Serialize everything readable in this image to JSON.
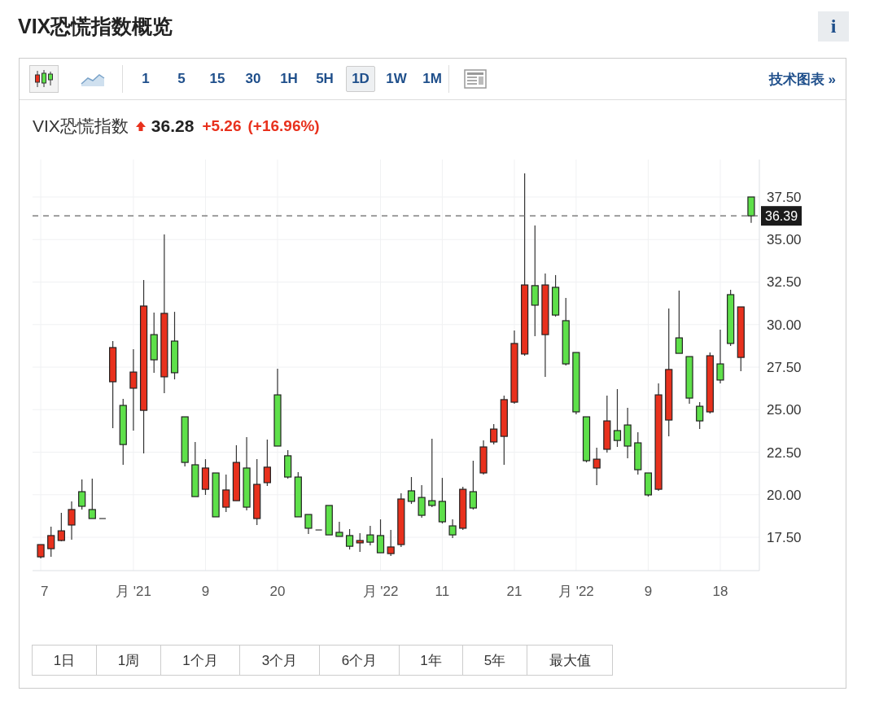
{
  "page_title": "VIX恐慌指数概览",
  "info_button": {
    "label": "i"
  },
  "toolbar": {
    "chart_types": [
      {
        "kind": "candlestick",
        "selected": true
      },
      {
        "kind": "line",
        "selected": false
      }
    ],
    "intervals": [
      {
        "label": "1",
        "selected": false
      },
      {
        "label": "5",
        "selected": false
      },
      {
        "label": "15",
        "selected": false
      },
      {
        "label": "30",
        "selected": false
      },
      {
        "label": "1H",
        "selected": false
      },
      {
        "label": "5H",
        "selected": false
      },
      {
        "label": "1D",
        "selected": true
      },
      {
        "label": "1W",
        "selected": false
      },
      {
        "label": "1M",
        "selected": false
      }
    ],
    "link": "技术图表 »"
  },
  "quote": {
    "name": "VIX恐慌指数",
    "rising": true,
    "price": "36.28",
    "change": "+5.26",
    "change_percent": "(+16.96%)"
  },
  "chart": {
    "last_price_tag": "36.39",
    "chart_data": {
      "type": "candlestick",
      "categories": [
        "7",
        null,
        null,
        null,
        null,
        null,
        null,
        null,
        null,
        "月 '21",
        null,
        null,
        null,
        null,
        null,
        null,
        "9",
        null,
        null,
        null,
        null,
        null,
        null,
        "20",
        null,
        null,
        null,
        null,
        null,
        null,
        null,
        null,
        null,
        "月 '22",
        null,
        null,
        null,
        null,
        null,
        "11",
        null,
        null,
        null,
        null,
        null,
        null,
        "21",
        null,
        null,
        null,
        null,
        null,
        "月 '22",
        null,
        null,
        null,
        null,
        null,
        null,
        "9",
        null,
        null,
        null,
        null,
        null,
        null,
        "18",
        null,
        null,
        null
      ],
      "ohlc": [
        [
          16.35,
          17.07,
          16.26,
          17.07
        ],
        [
          16.83,
          18.12,
          16.35,
          17.6
        ],
        [
          17.31,
          18.94,
          17.26,
          17.88
        ],
        [
          18.22,
          19.61,
          17.36,
          19.13
        ],
        [
          20.18,
          20.9,
          19.13,
          19.32
        ],
        [
          19.13,
          20.95,
          18.6,
          18.6
        ],
        [
          18.6,
          18.6,
          18.6,
          18.6
        ],
        [
          26.64,
          29.03,
          23.91,
          28.65
        ],
        [
          25.25,
          25.63,
          21.76,
          22.95
        ],
        [
          26.26,
          28.55,
          23.77,
          27.21
        ],
        [
          24.96,
          32.62,
          22.43,
          31.09
        ],
        [
          29.41,
          30.71,
          27.17,
          27.93
        ],
        [
          26.93,
          35.3,
          25.97,
          30.66
        ],
        [
          29.03,
          30.75,
          26.78,
          27.17
        ],
        [
          24.58,
          24.58,
          21.66,
          21.9
        ],
        [
          21.76,
          23.1,
          19.89,
          19.89
        ],
        [
          20.32,
          22.09,
          19.99,
          21.57
        ],
        [
          21.28,
          21.28,
          18.7,
          18.7
        ],
        [
          19.27,
          21.18,
          18.98,
          20.28
        ],
        [
          19.65,
          22.91,
          19.65,
          21.9
        ],
        [
          21.57,
          23.39,
          19.08,
          19.27
        ],
        [
          18.6,
          22.09,
          18.22,
          20.61
        ],
        [
          20.71,
          23.24,
          20.51,
          21.62
        ],
        [
          25.87,
          27.4,
          22.86,
          22.86
        ],
        [
          22.29,
          22.62,
          20.95,
          21.04
        ],
        [
          21.04,
          21.33,
          18.7,
          18.7
        ],
        [
          18.84,
          18.84,
          17.69,
          18.03
        ],
        [
          17.93,
          17.93,
          17.93,
          17.93
        ],
        [
          19.37,
          19.37,
          17.64,
          17.64
        ],
        [
          17.79,
          18.41,
          17.55,
          17.55
        ],
        [
          17.6,
          17.98,
          16.78,
          16.97
        ],
        [
          17.17,
          17.74,
          16.64,
          17.31
        ],
        [
          17.64,
          18.17,
          17.02,
          17.21
        ],
        [
          17.6,
          18.55,
          16.59,
          16.59
        ],
        [
          16.54,
          17.93,
          16.4,
          16.93
        ],
        [
          17.07,
          20.08,
          16.93,
          19.75
        ],
        [
          20.23,
          21.04,
          19.46,
          19.61
        ],
        [
          19.84,
          20.56,
          18.65,
          18.79
        ],
        [
          19.65,
          23.29,
          19.27,
          19.37
        ],
        [
          19.61,
          20.99,
          18.31,
          18.41
        ],
        [
          18.17,
          18.55,
          17.45,
          17.64
        ],
        [
          18.03,
          20.47,
          17.93,
          20.32
        ],
        [
          20.18,
          22.0,
          19.13,
          19.22
        ],
        [
          21.28,
          23.19,
          21.18,
          22.81
        ],
        [
          23.1,
          24.15,
          22.95,
          23.86
        ],
        [
          23.43,
          25.83,
          21.76,
          25.59
        ],
        [
          25.44,
          29.65,
          25.35,
          28.89
        ],
        [
          28.27,
          38.89,
          28.17,
          32.33
        ],
        [
          32.29,
          35.83,
          29.32,
          31.14
        ],
        [
          29.41,
          33.0,
          26.93,
          32.33
        ],
        [
          32.19,
          32.91,
          30.47,
          30.56
        ],
        [
          30.23,
          31.57,
          27.6,
          27.69
        ],
        [
          28.36,
          28.36,
          24.73,
          24.87
        ],
        [
          24.58,
          24.58,
          21.9,
          22.0
        ],
        [
          21.57,
          22.76,
          20.56,
          22.09
        ],
        [
          22.67,
          25.83,
          22.48,
          24.34
        ],
        [
          23.77,
          26.21,
          22.81,
          23.19
        ],
        [
          24.1,
          25.11,
          22.14,
          22.86
        ],
        [
          23.05,
          23.67,
          21.18,
          21.47
        ],
        [
          21.28,
          21.28,
          19.89,
          19.99
        ],
        [
          20.32,
          26.54,
          20.23,
          25.87
        ],
        [
          24.39,
          30.95,
          23.43,
          27.36
        ],
        [
          29.22,
          32.0,
          28.31,
          28.31
        ],
        [
          28.12,
          28.12,
          25.35,
          25.68
        ],
        [
          25.2,
          25.44,
          23.86,
          24.34
        ],
        [
          24.87,
          28.36,
          24.77,
          28.17
        ],
        [
          27.69,
          29.7,
          26.54,
          26.74
        ],
        [
          31.76,
          32.05,
          28.74,
          28.89
        ],
        [
          28.07,
          31.04,
          27.26,
          31.04
        ],
        [
          37.5,
          37.5,
          35.98,
          36.39
        ]
      ],
      "ylim": [
        15.54,
        39.7
      ],
      "grid": true,
      "ref_lines": [
        {
          "axis": "y",
          "value": 36.39,
          "color": "#666666"
        }
      ],
      "yticks": [
        {
          "value": 37.5,
          "label": "37.50"
        },
        {
          "value": 35,
          "label": "35.00"
        },
        {
          "value": 32.5,
          "label": "32.50"
        },
        {
          "value": 30,
          "label": "30.00"
        },
        {
          "value": 27.5,
          "label": "27.50"
        },
        {
          "value": 25,
          "label": "25.00"
        },
        {
          "value": 22.5,
          "label": "22.50"
        },
        {
          "value": 20,
          "label": "20.00"
        },
        {
          "value": 17.5,
          "label": "17.50"
        }
      ]
    }
  },
  "ranges": [
    "1日",
    "1周",
    "1个月",
    "3个月",
    "6个月",
    "1年",
    "5年",
    "最大值"
  ]
}
